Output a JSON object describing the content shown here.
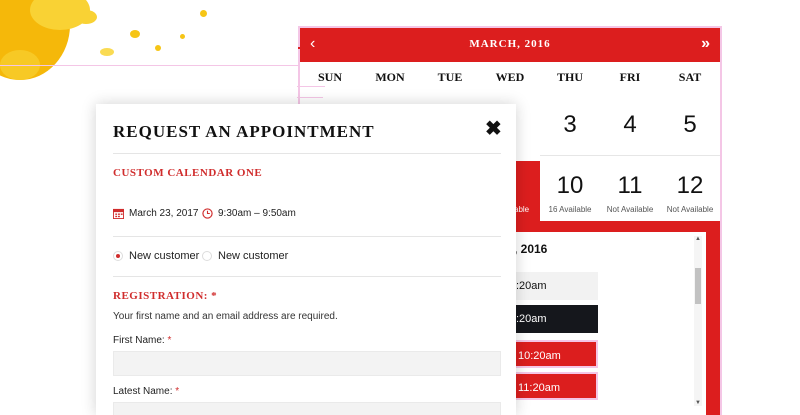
{
  "colors": {
    "accent": "#dc1e1e",
    "dark_slot": "#15171c",
    "pink_border": "#f4c6e6"
  },
  "calendar": {
    "month_title": "MARCH, 2016",
    "prev_icon": "chevron-left-icon",
    "next_icon": "double-chevron-right-icon",
    "weekdays": [
      "SUN",
      "MON",
      "TUE",
      "WED",
      "THU",
      "FRI",
      "SAT"
    ],
    "row1_days": [
      {
        "num": "3",
        "avail": ""
      },
      {
        "num": "4",
        "avail": ""
      },
      {
        "num": "5",
        "avail": ""
      }
    ],
    "row2_days": [
      {
        "num": "10",
        "avail": "16 Available"
      },
      {
        "num": "11",
        "avail": "Not Available"
      },
      {
        "num": "12",
        "avail": "Not Available"
      }
    ],
    "partial_cell_text": "able",
    "time_panel_title": "), 2016",
    "slots": [
      ":20am",
      ":20am",
      "10:20am",
      "11:20am"
    ]
  },
  "modal": {
    "title": "REQUEST AN APPOINTMENT",
    "close_icon": "close-icon",
    "calendar_name": "CUSTOM CALENDAR ONE",
    "date": "March 23, 2017",
    "time": "9:30am – 9:50am",
    "radio_options": [
      "New customer",
      "New customer"
    ],
    "registration_title": "REGISTRATION: *",
    "registration_help": "Your first name and an email address are required.",
    "fields": [
      {
        "label": "First Name:",
        "required": "*"
      },
      {
        "label": "Latest Name:",
        "required": "*"
      }
    ]
  }
}
